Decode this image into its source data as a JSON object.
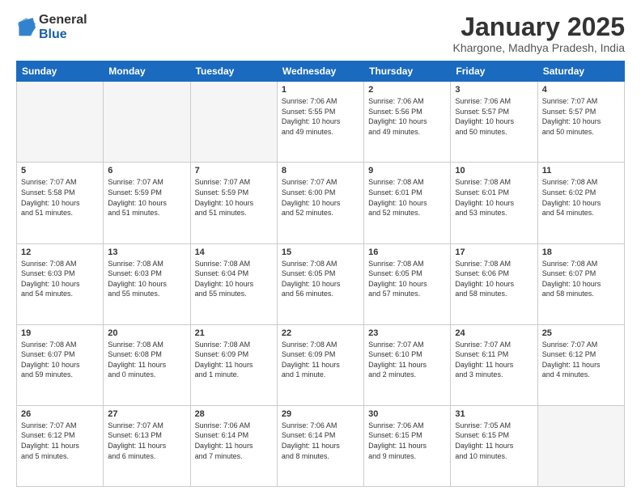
{
  "header": {
    "logo_general": "General",
    "logo_blue": "Blue",
    "month_title": "January 2025",
    "location": "Khargone, Madhya Pradesh, India"
  },
  "weekdays": [
    "Sunday",
    "Monday",
    "Tuesday",
    "Wednesday",
    "Thursday",
    "Friday",
    "Saturday"
  ],
  "weeks": [
    [
      {
        "day": "",
        "info": ""
      },
      {
        "day": "",
        "info": ""
      },
      {
        "day": "",
        "info": ""
      },
      {
        "day": "1",
        "info": "Sunrise: 7:06 AM\nSunset: 5:55 PM\nDaylight: 10 hours\nand 49 minutes."
      },
      {
        "day": "2",
        "info": "Sunrise: 7:06 AM\nSunset: 5:56 PM\nDaylight: 10 hours\nand 49 minutes."
      },
      {
        "day": "3",
        "info": "Sunrise: 7:06 AM\nSunset: 5:57 PM\nDaylight: 10 hours\nand 50 minutes."
      },
      {
        "day": "4",
        "info": "Sunrise: 7:07 AM\nSunset: 5:57 PM\nDaylight: 10 hours\nand 50 minutes."
      }
    ],
    [
      {
        "day": "5",
        "info": "Sunrise: 7:07 AM\nSunset: 5:58 PM\nDaylight: 10 hours\nand 51 minutes."
      },
      {
        "day": "6",
        "info": "Sunrise: 7:07 AM\nSunset: 5:59 PM\nDaylight: 10 hours\nand 51 minutes."
      },
      {
        "day": "7",
        "info": "Sunrise: 7:07 AM\nSunset: 5:59 PM\nDaylight: 10 hours\nand 51 minutes."
      },
      {
        "day": "8",
        "info": "Sunrise: 7:07 AM\nSunset: 6:00 PM\nDaylight: 10 hours\nand 52 minutes."
      },
      {
        "day": "9",
        "info": "Sunrise: 7:08 AM\nSunset: 6:01 PM\nDaylight: 10 hours\nand 52 minutes."
      },
      {
        "day": "10",
        "info": "Sunrise: 7:08 AM\nSunset: 6:01 PM\nDaylight: 10 hours\nand 53 minutes."
      },
      {
        "day": "11",
        "info": "Sunrise: 7:08 AM\nSunset: 6:02 PM\nDaylight: 10 hours\nand 54 minutes."
      }
    ],
    [
      {
        "day": "12",
        "info": "Sunrise: 7:08 AM\nSunset: 6:03 PM\nDaylight: 10 hours\nand 54 minutes."
      },
      {
        "day": "13",
        "info": "Sunrise: 7:08 AM\nSunset: 6:03 PM\nDaylight: 10 hours\nand 55 minutes."
      },
      {
        "day": "14",
        "info": "Sunrise: 7:08 AM\nSunset: 6:04 PM\nDaylight: 10 hours\nand 55 minutes."
      },
      {
        "day": "15",
        "info": "Sunrise: 7:08 AM\nSunset: 6:05 PM\nDaylight: 10 hours\nand 56 minutes."
      },
      {
        "day": "16",
        "info": "Sunrise: 7:08 AM\nSunset: 6:05 PM\nDaylight: 10 hours\nand 57 minutes."
      },
      {
        "day": "17",
        "info": "Sunrise: 7:08 AM\nSunset: 6:06 PM\nDaylight: 10 hours\nand 58 minutes."
      },
      {
        "day": "18",
        "info": "Sunrise: 7:08 AM\nSunset: 6:07 PM\nDaylight: 10 hours\nand 58 minutes."
      }
    ],
    [
      {
        "day": "19",
        "info": "Sunrise: 7:08 AM\nSunset: 6:07 PM\nDaylight: 10 hours\nand 59 minutes."
      },
      {
        "day": "20",
        "info": "Sunrise: 7:08 AM\nSunset: 6:08 PM\nDaylight: 11 hours\nand 0 minutes."
      },
      {
        "day": "21",
        "info": "Sunrise: 7:08 AM\nSunset: 6:09 PM\nDaylight: 11 hours\nand 1 minute."
      },
      {
        "day": "22",
        "info": "Sunrise: 7:08 AM\nSunset: 6:09 PM\nDaylight: 11 hours\nand 1 minute."
      },
      {
        "day": "23",
        "info": "Sunrise: 7:07 AM\nSunset: 6:10 PM\nDaylight: 11 hours\nand 2 minutes."
      },
      {
        "day": "24",
        "info": "Sunrise: 7:07 AM\nSunset: 6:11 PM\nDaylight: 11 hours\nand 3 minutes."
      },
      {
        "day": "25",
        "info": "Sunrise: 7:07 AM\nSunset: 6:12 PM\nDaylight: 11 hours\nand 4 minutes."
      }
    ],
    [
      {
        "day": "26",
        "info": "Sunrise: 7:07 AM\nSunset: 6:12 PM\nDaylight: 11 hours\nand 5 minutes."
      },
      {
        "day": "27",
        "info": "Sunrise: 7:07 AM\nSunset: 6:13 PM\nDaylight: 11 hours\nand 6 minutes."
      },
      {
        "day": "28",
        "info": "Sunrise: 7:06 AM\nSunset: 6:14 PM\nDaylight: 11 hours\nand 7 minutes."
      },
      {
        "day": "29",
        "info": "Sunrise: 7:06 AM\nSunset: 6:14 PM\nDaylight: 11 hours\nand 8 minutes."
      },
      {
        "day": "30",
        "info": "Sunrise: 7:06 AM\nSunset: 6:15 PM\nDaylight: 11 hours\nand 9 minutes."
      },
      {
        "day": "31",
        "info": "Sunrise: 7:05 AM\nSunset: 6:15 PM\nDaylight: 11 hours\nand 10 minutes."
      },
      {
        "day": "",
        "info": ""
      }
    ]
  ]
}
